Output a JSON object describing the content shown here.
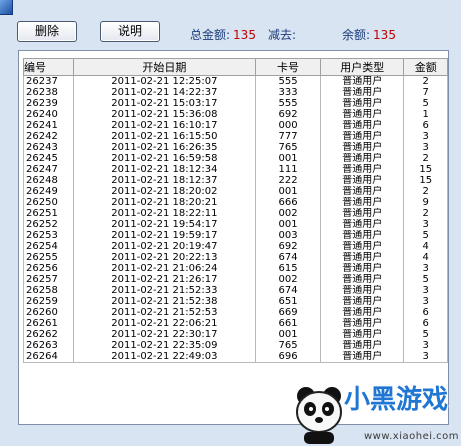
{
  "toolbar": {
    "delete_label": "删除",
    "help_label": "说明",
    "total_label": "总金额:",
    "total_value": "135",
    "minus_label": "减去:",
    "minus_value": "",
    "balance_label": "余额:",
    "balance_value": "135"
  },
  "table": {
    "columns": [
      "编号",
      "开始日期",
      "卡号",
      "用户类型",
      "金额"
    ],
    "rows": [
      [
        "26237",
        "2011-02-21 12:25:07",
        "555",
        "普通用户",
        "2"
      ],
      [
        "26238",
        "2011-02-21 14:22:37",
        "333",
        "普通用户",
        "7"
      ],
      [
        "26239",
        "2011-02-21 15:03:17",
        "555",
        "普通用户",
        "5"
      ],
      [
        "26240",
        "2011-02-21 15:36:08",
        "692",
        "普通用户",
        "1"
      ],
      [
        "26241",
        "2011-02-21 16:10:17",
        "000",
        "普通用户",
        "6"
      ],
      [
        "26242",
        "2011-02-21 16:15:50",
        "777",
        "普通用户",
        "3"
      ],
      [
        "26243",
        "2011-02-21 16:26:35",
        "765",
        "普通用户",
        "3"
      ],
      [
        "26245",
        "2011-02-21 16:59:58",
        "001",
        "普通用户",
        "2"
      ],
      [
        "26247",
        "2011-02-21 18:12:34",
        "111",
        "普通用户",
        "15"
      ],
      [
        "26248",
        "2011-02-21 18:12:37",
        "222",
        "普通用户",
        "15"
      ],
      [
        "26249",
        "2011-02-21 18:20:02",
        "001",
        "普通用户",
        "2"
      ],
      [
        "26250",
        "2011-02-21 18:20:21",
        "666",
        "普通用户",
        "9"
      ],
      [
        "26251",
        "2011-02-21 18:22:11",
        "002",
        "普通用户",
        "2"
      ],
      [
        "26252",
        "2011-02-21 19:54:17",
        "001",
        "普通用户",
        "3"
      ],
      [
        "26253",
        "2011-02-21 19:59:17",
        "003",
        "普通用户",
        "5"
      ],
      [
        "26254",
        "2011-02-21 20:19:47",
        "692",
        "普通用户",
        "4"
      ],
      [
        "26255",
        "2011-02-21 20:22:13",
        "674",
        "普通用户",
        "4"
      ],
      [
        "26256",
        "2011-02-21 21:06:24",
        "615",
        "普通用户",
        "3"
      ],
      [
        "26257",
        "2011-02-21 21:26:17",
        "002",
        "普通用户",
        "5"
      ],
      [
        "26258",
        "2011-02-21 21:52:33",
        "674",
        "普通用户",
        "3"
      ],
      [
        "26259",
        "2011-02-21 21:52:38",
        "651",
        "普通用户",
        "3"
      ],
      [
        "26260",
        "2011-02-21 21:52:53",
        "669",
        "普通用户",
        "6"
      ],
      [
        "26261",
        "2011-02-21 22:06:21",
        "661",
        "普通用户",
        "6"
      ],
      [
        "26262",
        "2011-02-21 22:30:17",
        "001",
        "普通用户",
        "5"
      ],
      [
        "26263",
        "2011-02-21 22:35:09",
        "765",
        "普通用户",
        "3"
      ],
      [
        "26264",
        "2011-02-21 22:49:03",
        "696",
        "普通用户",
        "3"
      ]
    ]
  },
  "watermark": {
    "logo_text": "小黑游戏",
    "url": "www.xiaohei.com"
  }
}
